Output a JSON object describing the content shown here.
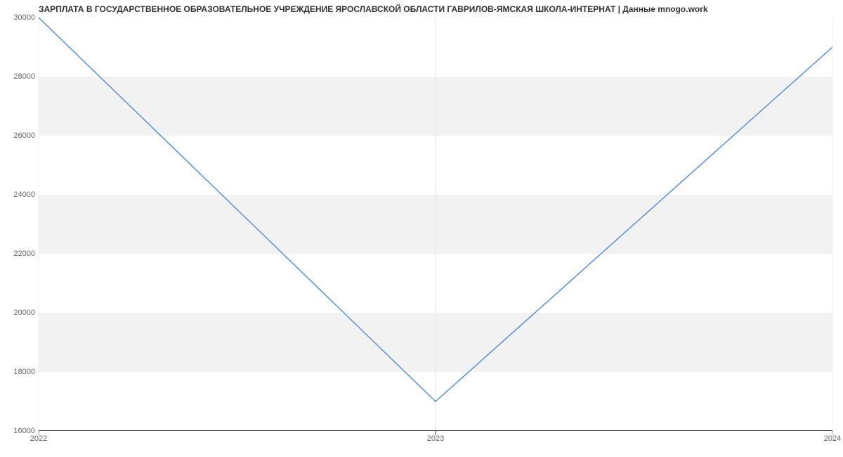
{
  "chart_data": {
    "type": "line",
    "title": "ЗАРПЛАТА В ГОСУДАРСТВЕННОЕ ОБРАЗОВАТЕЛЬНОЕ УЧРЕЖДЕНИЕ ЯРОСЛАВСКОЙ ОБЛАСТИ ГАВРИЛОВ-ЯМСКАЯ ШКОЛА-ИНТЕРНАТ | Данные mnogo.work",
    "x": [
      "2022",
      "2023",
      "2024"
    ],
    "values": [
      30000,
      17000,
      29000
    ],
    "x_ticks": [
      "2022",
      "2023",
      "2024"
    ],
    "y_ticks": [
      16000,
      18000,
      20000,
      22000,
      24000,
      26000,
      28000,
      30000
    ],
    "ylim": [
      16000,
      30000
    ],
    "line_color": "#5b8fd6",
    "band_color": "#f2f2f2",
    "axis_color": "#333333",
    "grid_color": "#e6e6e6"
  }
}
